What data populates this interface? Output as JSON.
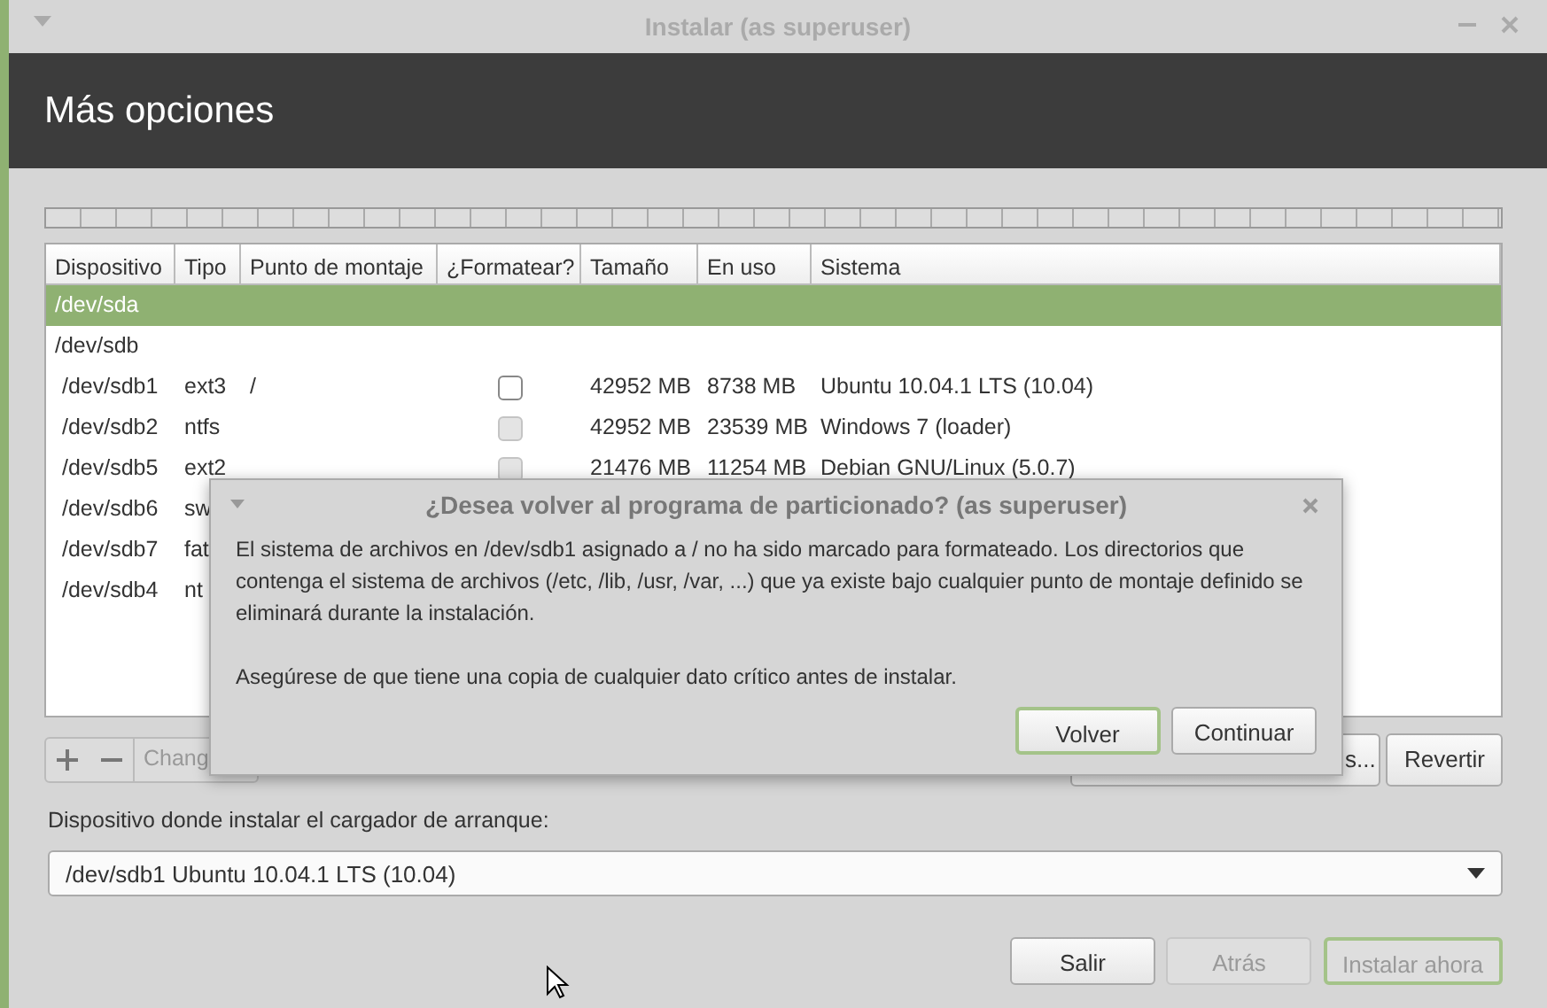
{
  "window": {
    "title": "Instalar (as superuser)"
  },
  "header": {
    "title": "Más opciones"
  },
  "table": {
    "columns": [
      "Dispositivo",
      "Tipo",
      "Punto de montaje",
      "¿Formatear?",
      "Tamaño",
      "En uso",
      "Sistema"
    ],
    "rows": [
      {
        "kind": "device",
        "device": "/dev/sda",
        "selected": true
      },
      {
        "kind": "device",
        "device": "/dev/sdb",
        "selected": false
      },
      {
        "kind": "partition",
        "device": "/dev/sdb1",
        "type": "ext3",
        "mount": "/",
        "format": {
          "checked": false,
          "disabled": false
        },
        "size": "42952 MB",
        "used": "8738 MB",
        "system": "Ubuntu 10.04.1 LTS (10.04)",
        "selected": false
      },
      {
        "kind": "partition",
        "device": "/dev/sdb2",
        "type": "ntfs",
        "format": {
          "checked": false,
          "disabled": true
        },
        "size": "42952 MB",
        "used": "23539 MB",
        "system": "Windows 7 (loader)",
        "selected": false
      },
      {
        "kind": "partition",
        "device": "/dev/sdb5",
        "type": "ext2",
        "format": {
          "checked": false,
          "disabled": true
        },
        "size": "21476 MB",
        "used": "11254 MB",
        "system": "Debian GNU/Linux (5.0.7)",
        "selected": false
      },
      {
        "kind": "partition",
        "device": "/dev/sdb6",
        "type": "sw",
        "selected": false
      },
      {
        "kind": "partition",
        "device": "/dev/sdb7",
        "type": "fat",
        "selected": false
      },
      {
        "kind": "partition",
        "device": "/dev/sdb4",
        "type": "nt",
        "selected": false
      }
    ]
  },
  "toolbar": {
    "change_button": "Chang",
    "hidden_button": "s...",
    "revert_button": "Revertir"
  },
  "bootloader": {
    "label": "Dispositivo donde instalar el cargador de arranque:",
    "value": "/dev/sdb1  Ubuntu 10.04.1 LTS (10.04)"
  },
  "buttons": [
    {
      "label": "Salir",
      "disabled": false,
      "default": false
    },
    {
      "label": "Atrás",
      "disabled": true,
      "default": false
    },
    {
      "label": "Instalar ahora",
      "disabled": true,
      "default": true
    }
  ],
  "dialog": {
    "title": "¿Desea volver al programa de particionado? (as superuser)",
    "paragraphs": [
      "El sistema de archivos en /dev/sdb1 asignado a / no ha sido marcado para formateado. Los directorios que contenga el sistema de archivos (/etc, /lib, /usr, /var, ...) que ya existe bajo cualquier punto de montaje definido se eliminará durante la instalación.",
      "Asegúrese de que tiene una copia de cualquier dato crítico antes de instalar."
    ],
    "buttons": [
      {
        "label": "Volver",
        "default": true
      },
      {
        "label": "Continuar",
        "default": false
      }
    ]
  }
}
